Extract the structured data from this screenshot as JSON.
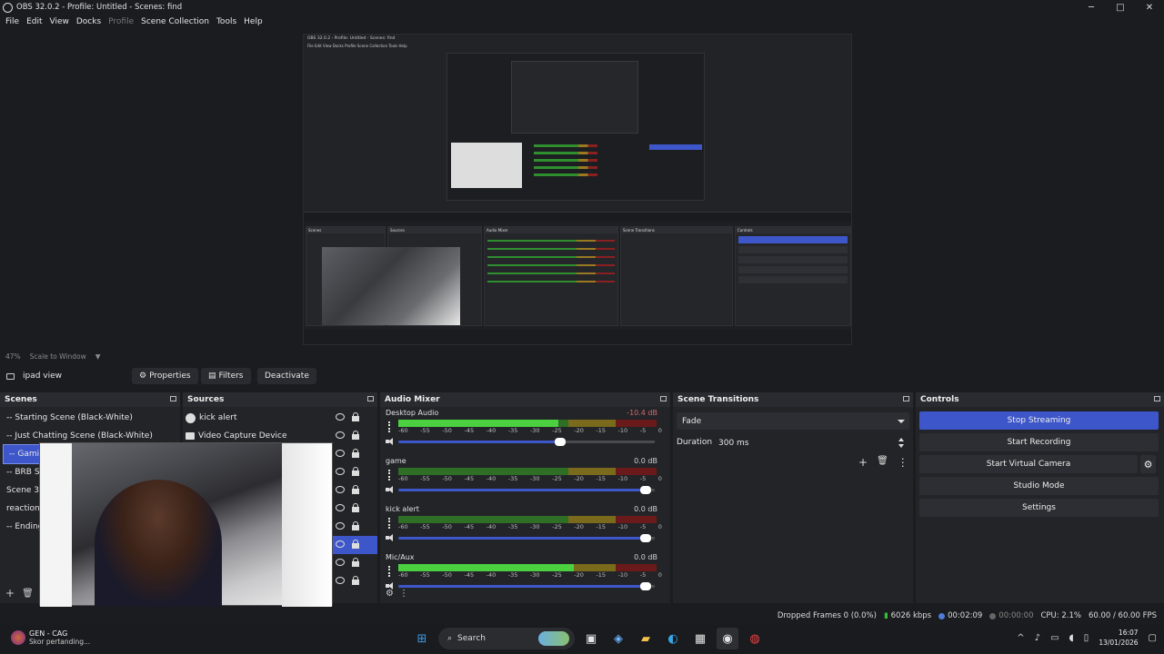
{
  "window": {
    "title": "OBS 32.0.2 - Profile: Untitled - Scenes: find",
    "minimize": "─",
    "maximize": "□",
    "close": "✕"
  },
  "menu": [
    "File",
    "Edit",
    "View",
    "Docks",
    "Profile",
    "Scene Collection",
    "Tools",
    "Help"
  ],
  "preview": {
    "nested_title": "OBS 32.0.2 - Profile: Untitled - Scenes: find",
    "nested_menu": "File  Edit  View  Docks  Profile  Scene Collection  Tools  Help"
  },
  "scale": {
    "zoom": "47%",
    "mode": "Scale to Window"
  },
  "scene_toolbar": {
    "current_scene": "ipad view",
    "properties": "Properties",
    "filters": "Filters",
    "deactivate": "Deactivate"
  },
  "scenes": {
    "title": "Scenes",
    "items": [
      "-- Starting Scene (Black-White)",
      "-- Just Chatting Scene (Black-White)",
      "-- Gaming",
      "-- BRB Scene",
      "Scene 3",
      "reaction",
      "-- Ending"
    ],
    "selected_index": 2,
    "add": "+",
    "remove": "🗑"
  },
  "sources": {
    "title": "Sources",
    "items": [
      {
        "name": "kick alert",
        "icon": "browser-icon"
      },
      {
        "name": "Video Capture Device",
        "icon": "camera-icon"
      }
    ]
  },
  "audio_mixer": {
    "title": "Audio Mixer",
    "ticks": [
      "-60",
      "-55",
      "-50",
      "-45",
      "-40",
      "-35",
      "-30",
      "-25",
      "-20",
      "-15",
      "-10",
      "-5",
      "0"
    ],
    "channels": [
      {
        "name": "Desktop Audio",
        "db": "-10.4 dB",
        "db_color": "#d46a6a",
        "level": 0.62,
        "volume": 0.64
      },
      {
        "name": "game",
        "db": "0.0 dB",
        "db_color": "#d0d0d0",
        "level": 0.0,
        "volume": 0.97
      },
      {
        "name": "kick alert",
        "db": "0.0 dB",
        "db_color": "#d0d0d0",
        "level": 0.0,
        "volume": 0.97
      },
      {
        "name": "Mic/Aux",
        "db": "0.0 dB",
        "db_color": "#d0d0d0",
        "level": 0.68,
        "volume": 0.97
      }
    ]
  },
  "transitions": {
    "title": "Scene Transitions",
    "selected": "Fade",
    "duration_label": "Duration",
    "duration": "300 ms"
  },
  "controls": {
    "title": "Controls",
    "stop_streaming": "Stop Streaming",
    "start_recording": "Start Recording",
    "start_virtual_camera": "Start Virtual Camera",
    "studio_mode": "Studio Mode",
    "settings": "Settings"
  },
  "status": {
    "dropped_frames": "Dropped Frames 0 (0.0%)",
    "bitrate": "6026 kbps",
    "stream_time": "00:02:09",
    "record_time": "00:00:00",
    "cpu": "CPU: 2.1%",
    "fps": "60.00 / 60.00 FPS"
  },
  "taskbar": {
    "widget_title": "GEN - CAG",
    "widget_subtitle": "Skor pertanding...",
    "search": "Search",
    "time": "16:07",
    "date": "13/01/2026"
  },
  "colors": {
    "accent": "#3d56c9",
    "background": "#1b1c1f",
    "panel": "#232428"
  }
}
